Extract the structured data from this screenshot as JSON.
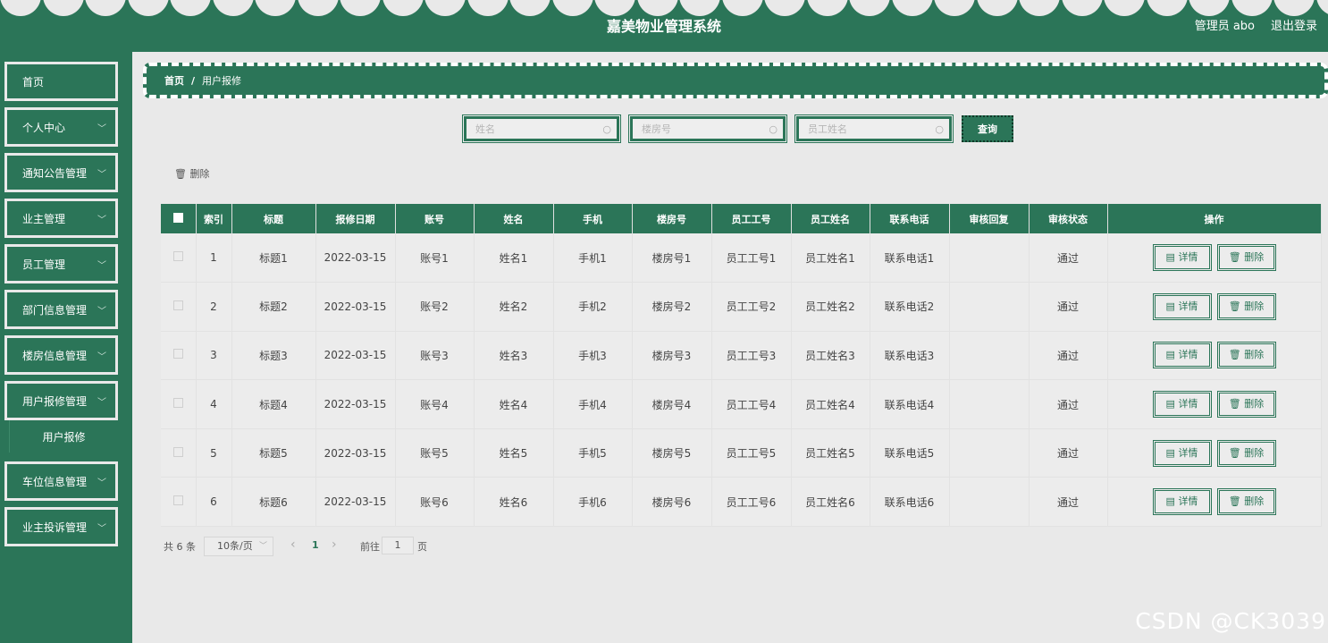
{
  "app_title": "嘉美物业管理系统",
  "header": {
    "user": "管理员 abo",
    "logout": "退出登录"
  },
  "sidebar": {
    "items": [
      {
        "label": "首页",
        "has_children": false
      },
      {
        "label": "个人中心",
        "has_children": true
      },
      {
        "label": "通知公告管理",
        "has_children": true
      },
      {
        "label": "业主管理",
        "has_children": true
      },
      {
        "label": "员工管理",
        "has_children": true
      },
      {
        "label": "部门信息管理",
        "has_children": true
      },
      {
        "label": "楼房信息管理",
        "has_children": true
      },
      {
        "label": "用户报修管理",
        "has_children": true,
        "expanded": true
      },
      {
        "label": "车位信息管理",
        "has_children": true
      },
      {
        "label": "业主投诉管理",
        "has_children": true
      }
    ],
    "submenu": {
      "label": "用户报修"
    }
  },
  "breadcrumb": {
    "home": "首页",
    "separator": "/",
    "current": "用户报修"
  },
  "search": {
    "fields": [
      {
        "placeholder": "姓名"
      },
      {
        "placeholder": "楼房号"
      },
      {
        "placeholder": "员工姓名"
      }
    ],
    "button": "查询"
  },
  "toolbar": {
    "delete_label": "删除"
  },
  "table": {
    "columns": [
      "索引",
      "标题",
      "报修日期",
      "账号",
      "姓名",
      "手机",
      "楼房号",
      "员工工号",
      "员工姓名",
      "联系电话",
      "审核回复",
      "审核状态",
      "操作"
    ],
    "rows": [
      [
        "1",
        "标题1",
        "2022-03-15",
        "账号1",
        "姓名1",
        "手机1",
        "楼房号1",
        "员工工号1",
        "员工姓名1",
        "联系电话1",
        "",
        "通过"
      ],
      [
        "2",
        "标题2",
        "2022-03-15",
        "账号2",
        "姓名2",
        "手机2",
        "楼房号2",
        "员工工号2",
        "员工姓名2",
        "联系电话2",
        "",
        "通过"
      ],
      [
        "3",
        "标题3",
        "2022-03-15",
        "账号3",
        "姓名3",
        "手机3",
        "楼房号3",
        "员工工号3",
        "员工姓名3",
        "联系电话3",
        "",
        "通过"
      ],
      [
        "4",
        "标题4",
        "2022-03-15",
        "账号4",
        "姓名4",
        "手机4",
        "楼房号4",
        "员工工号4",
        "员工姓名4",
        "联系电话4",
        "",
        "通过"
      ],
      [
        "5",
        "标题5",
        "2022-03-15",
        "账号5",
        "姓名5",
        "手机5",
        "楼房号5",
        "员工工号5",
        "员工姓名5",
        "联系电话5",
        "",
        "通过"
      ],
      [
        "6",
        "标题6",
        "2022-03-15",
        "账号6",
        "姓名6",
        "手机6",
        "楼房号6",
        "员工工号6",
        "员工姓名6",
        "联系电话6",
        "",
        "通过"
      ]
    ],
    "actions": {
      "detail": "详情",
      "delete": "删除"
    }
  },
  "pagination": {
    "total": "共 6 条",
    "page_size": "10条/页",
    "prev": "‹",
    "current_page": "1",
    "next": "›",
    "goto_label": "前往",
    "goto_value": "1",
    "page_suffix": "页"
  },
  "watermark": "CSDN @CK3039",
  "colors": {
    "primary": "#2b7558",
    "background": "#e9e9e9"
  }
}
